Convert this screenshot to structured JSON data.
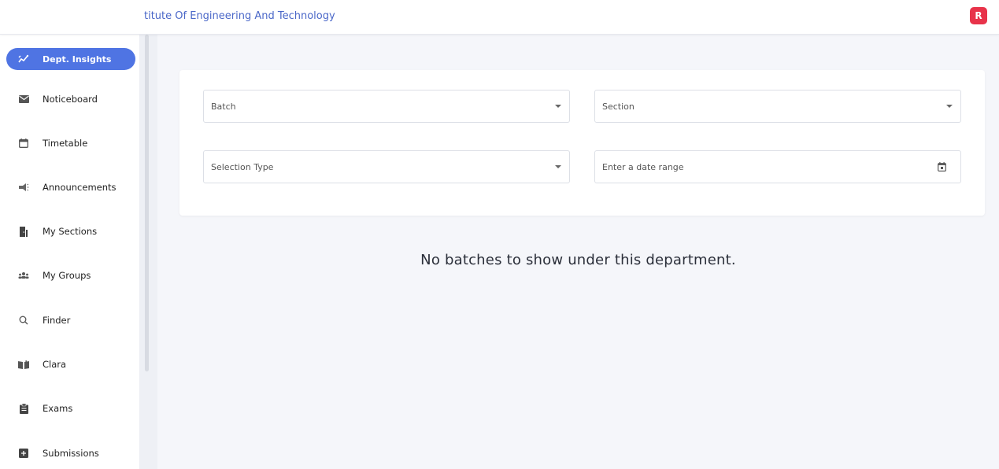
{
  "header": {
    "title": "titute Of Engineering And Technology",
    "avatar_initial": "R"
  },
  "sidebar": {
    "items": [
      {
        "label": "Dept. Insights",
        "icon": "chart-line-icon",
        "active": true
      },
      {
        "label": "Noticeboard",
        "icon": "mail-icon"
      },
      {
        "label": "Timetable",
        "icon": "calendar-icon"
      },
      {
        "label": "Announcements",
        "icon": "megaphone-icon"
      },
      {
        "label": "My Sections",
        "icon": "door-icon"
      },
      {
        "label": "My Groups",
        "icon": "groups-icon"
      },
      {
        "label": "Finder",
        "icon": "search-icon"
      },
      {
        "label": "Clara",
        "icon": "book-icon"
      },
      {
        "label": "Exams",
        "icon": "clipboard-icon"
      },
      {
        "label": "Submissions",
        "icon": "submission-icon"
      }
    ]
  },
  "filters": {
    "batch_placeholder": "Batch",
    "section_placeholder": "Section",
    "selection_type_placeholder": "Selection Type",
    "date_range_placeholder": "Enter a date range"
  },
  "main": {
    "empty_message": "No batches to show under this department."
  },
  "colors": {
    "accent": "#4f74e3",
    "avatar": "#e8334a",
    "title": "#4a67c8"
  }
}
